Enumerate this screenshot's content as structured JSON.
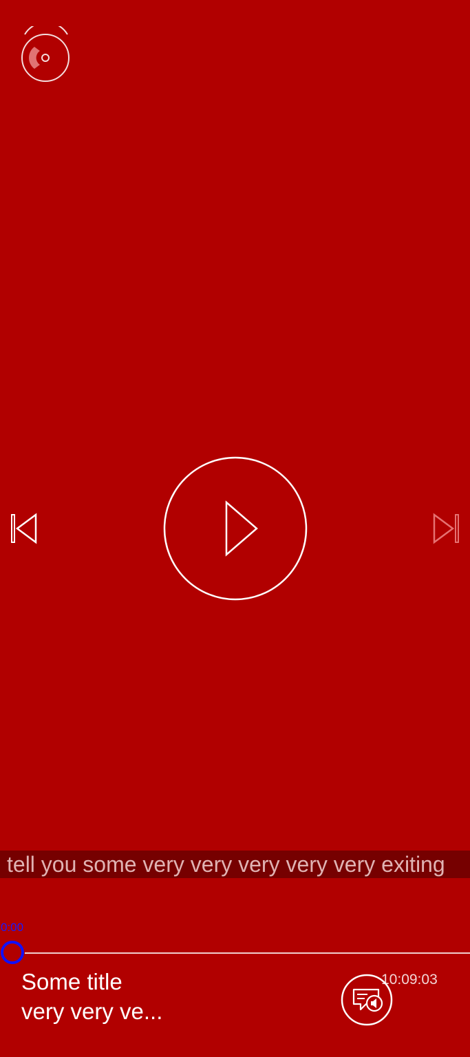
{
  "colors": {
    "background": "#b10000",
    "ticker_background": "#760000",
    "thumb": "#1010ff"
  },
  "icons": {
    "disc": "disc-icon",
    "previous": "skip-previous-icon",
    "play": "play-icon",
    "next": "skip-next-icon",
    "playlist": "playlist-audio-icon"
  },
  "ticker": {
    "text": "tell you some very very very very very exiting"
  },
  "progress": {
    "elapsed": "0:00",
    "fraction": 0
  },
  "now_playing": {
    "title": "Some title",
    "subtitle": "very very ve..."
  },
  "status": {
    "clock": "10:09:03"
  }
}
